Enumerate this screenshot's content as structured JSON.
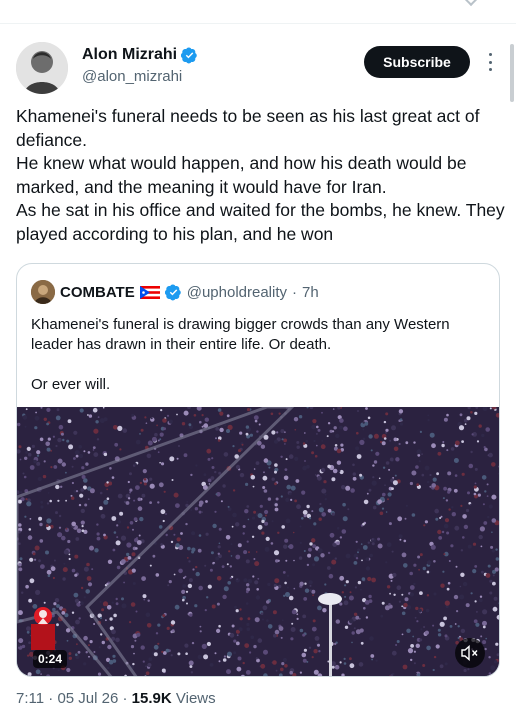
{
  "post": {
    "author_name": "Alon Mizrahi",
    "author_handle": "@alon_mizrahi",
    "subscribe_label": "Subscribe",
    "text_lines": [
      "Khamenei's funeral needs to be seen as his last great act of defiance.",
      "He knew what would happen, and how his death would be marked, and the meaning it would have for Iran.",
      "As he sat in his office and waited for the bombs, he knew. They played according to his plan, and he won"
    ],
    "time": "7:11",
    "date": "05 Jul 26",
    "views_count": "15.9K",
    "views_label": "Views",
    "separator": "·"
  },
  "quote": {
    "author_name": "COMBATE",
    "author_handle": "@upholdreality",
    "age": "7h",
    "separator": "·",
    "paragraphs": [
      "Khamenei's funeral is drawing bigger crowds than any Western leader has drawn in their entire life. Or death.",
      "Or ever will."
    ],
    "video_duration": "0:24"
  },
  "icons": {
    "verified": "verified-badge-icon",
    "more": "more-options-icon",
    "mute": "muted-speaker-icon",
    "flag": "puerto-rico-flag-icon"
  },
  "colors": {
    "verified_blue": "#1d9bf0",
    "text_primary": "#0f1419",
    "text_secondary": "#536471",
    "border": "#cfd9de",
    "button_bg": "#0f1419"
  }
}
